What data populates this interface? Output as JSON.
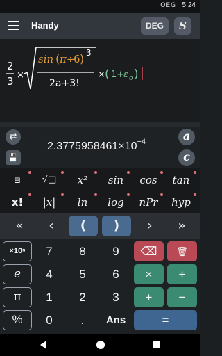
{
  "status": {
    "time": "5:24",
    "badge": "OEG"
  },
  "app": {
    "title": "Handy",
    "angle_mode": "DEG",
    "s_label": "S"
  },
  "expression": {
    "frac_num": "2",
    "frac_den": "3",
    "times": "×",
    "sin": "sin",
    "pi": "π",
    "div": "÷",
    "six": "6",
    "cube": "3",
    "denom": "2a+3!",
    "tail_open": "(",
    "tail_one": "1+",
    "epsilon": "ε",
    "sub": "o",
    "tail_close": ")"
  },
  "result": {
    "mantissa": "2.3775958461",
    "times": "×",
    "base": "10",
    "exponent": "−4"
  },
  "side_buttons": {
    "swap": "⇄",
    "save": "💾",
    "a": "a",
    "c": "c"
  },
  "fn_row1": [
    "⊟",
    "√□",
    "x²",
    "sin",
    "cos",
    "tan"
  ],
  "fn_row2": [
    "x!",
    "|x|",
    "ln",
    "log",
    "nPr",
    "hyp"
  ],
  "nav_row": [
    "«",
    "‹",
    "(",
    ")",
    "›",
    "»"
  ],
  "keypad": {
    "row1": [
      "×10ⁿ",
      "7",
      "8",
      "9",
      "⌫",
      "🗑"
    ],
    "row2": [
      "e",
      "4",
      "5",
      "6",
      "×",
      "÷"
    ],
    "row3": [
      "π",
      "1",
      "2",
      "3",
      "+",
      "−"
    ],
    "row4": [
      "%",
      "0",
      ".",
      "Ans",
      "="
    ]
  },
  "colors": {
    "accent_orange": "#e09a3a",
    "accent_green": "#7fc79a",
    "result_blue": "#4a6a8f"
  }
}
